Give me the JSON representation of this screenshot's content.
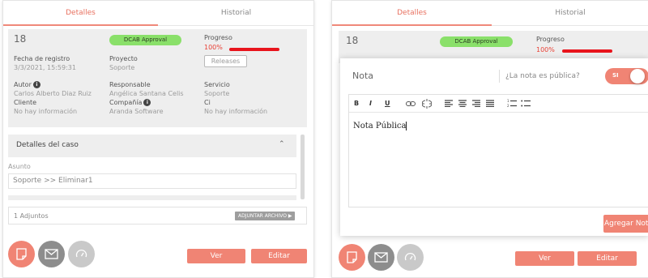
{
  "left": {
    "tabs": {
      "details": "Detalles",
      "history": "Historial"
    },
    "case_id": "18",
    "status": "DCAB Approval",
    "progress": {
      "label": "Progreso",
      "percent_text": "100%",
      "value": 1.0
    },
    "registration": {
      "label": "Fecha de registro",
      "value": "3/3/2021, 15:59:31"
    },
    "project": {
      "label": "Proyecto",
      "value": "Soporte"
    },
    "releases_label": "Releases",
    "author": {
      "label": "Autor",
      "value": "Carlos Alberto Diaz Ruiz"
    },
    "responsible": {
      "label": "Responsable",
      "value": "Angélica Santana Celis"
    },
    "service": {
      "label": "Servicio",
      "value": "Soporte"
    },
    "client": {
      "label": "Cliente",
      "value": "No hay información"
    },
    "company": {
      "label": "Compañía",
      "value": "Aranda Software"
    },
    "ci": {
      "label": "Ci",
      "value": "No hay información"
    },
    "case_details_title": "Detalles del caso",
    "subject": {
      "label": "Asunto",
      "value": "Soporte >> Eliminar1"
    },
    "attachments": {
      "count_label": "1 Adjuntos",
      "button": "ADJUNTAR ARCHIVO ▶"
    },
    "actions": {
      "view": "Ver",
      "edit": "Editar"
    }
  },
  "right": {
    "tabs": {
      "details": "Detalles",
      "history": "Historial"
    },
    "case_id": "18",
    "status": "DCAB Approval",
    "progress": {
      "label": "Progreso",
      "percent_text": "100%",
      "value": 1.0
    },
    "note": {
      "title": "Nota",
      "public_question": "¿La nota es pública?",
      "toggle_label": "SI",
      "toolbar": {
        "bold": "B",
        "italic": "I",
        "underline": "U"
      },
      "body_text": "Nota Pública",
      "add_button": "Agregar Nota"
    },
    "actions": {
      "view": "Ver",
      "edit": "Editar"
    }
  },
  "colors": {
    "accent": "#f08474",
    "status_green": "#8ae06a",
    "progress_red": "#e8141c"
  }
}
